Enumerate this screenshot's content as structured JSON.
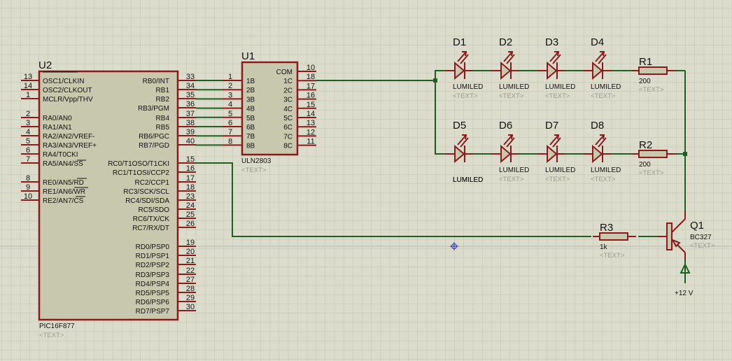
{
  "colors": {
    "background": "#dcdccc",
    "grid": "#c4c4b4",
    "wire": "#1f5f1f",
    "pin": "#8b1a1a",
    "body": "#c8c8ae",
    "cursor": "#2030c0"
  },
  "placeholder": "<TEXT>",
  "u2": {
    "ref": "U2",
    "value": "PIC16F877",
    "text": "<TEXT>",
    "left_pins": [
      {
        "num": "13",
        "label": "OSC1/CLKIN"
      },
      {
        "num": "14",
        "label": "OSC2/CLKOUT"
      },
      {
        "num": "1",
        "label": "MCLR/Vpp/THV"
      },
      {
        "num": "2",
        "label": "RA0/AN0"
      },
      {
        "num": "3",
        "label": "RA1/AN1"
      },
      {
        "num": "4",
        "label": "RA2/AN2/VREF-"
      },
      {
        "num": "5",
        "label": "RA3/AN3/VREF+"
      },
      {
        "num": "6",
        "label": "RA4/T0CKI"
      },
      {
        "num": "7",
        "label": "RA5/AN4/SS"
      },
      {
        "num": "8",
        "label": "RE0/AN5/RD"
      },
      {
        "num": "9",
        "label": "RE1/AN6/WR"
      },
      {
        "num": "10",
        "label": "RE2/AN7/CS"
      }
    ],
    "right_pins": [
      {
        "num": "33",
        "label": "RB0/INT"
      },
      {
        "num": "34",
        "label": "RB1"
      },
      {
        "num": "35",
        "label": "RB2"
      },
      {
        "num": "36",
        "label": "RB3/PGM"
      },
      {
        "num": "37",
        "label": "RB4"
      },
      {
        "num": "38",
        "label": "RB5"
      },
      {
        "num": "39",
        "label": "RB6/PGC"
      },
      {
        "num": "40",
        "label": "RB7/PGD"
      },
      {
        "num": "15",
        "label": "RC0/T1OSO/T1CKI"
      },
      {
        "num": "16",
        "label": "RC1/T1OSI/CCP2"
      },
      {
        "num": "17",
        "label": "RC2/CCP1"
      },
      {
        "num": "18",
        "label": "RC3/SCK/SCL"
      },
      {
        "num": "23",
        "label": "RC4/SDI/SDA"
      },
      {
        "num": "24",
        "label": "RC5/SDO"
      },
      {
        "num": "25",
        "label": "RC6/TX/CK"
      },
      {
        "num": "26",
        "label": "RC7/RX/DT"
      },
      {
        "num": "19",
        "label": "RD0/PSP0"
      },
      {
        "num": "20",
        "label": "RD1/PSP1"
      },
      {
        "num": "21",
        "label": "RD2/PSP2"
      },
      {
        "num": "22",
        "label": "RD3/PSP3"
      },
      {
        "num": "27",
        "label": "RD4/PSP4"
      },
      {
        "num": "28",
        "label": "RD5/PSP5"
      },
      {
        "num": "29",
        "label": "RD6/PSP6"
      },
      {
        "num": "30",
        "label": "RD7/PSP7"
      }
    ]
  },
  "u1": {
    "ref": "U1",
    "value": "ULN2803",
    "text": "<TEXT>",
    "left_pins": [
      {
        "num": "1",
        "label": "1B"
      },
      {
        "num": "2",
        "label": "2B"
      },
      {
        "num": "3",
        "label": "3B"
      },
      {
        "num": "4",
        "label": "4B"
      },
      {
        "num": "5",
        "label": "5B"
      },
      {
        "num": "6",
        "label": "6B"
      },
      {
        "num": "7",
        "label": "7B"
      },
      {
        "num": "8",
        "label": "8B"
      }
    ],
    "right_pins": [
      {
        "num": "10",
        "label": "COM"
      },
      {
        "num": "18",
        "label": "1C"
      },
      {
        "num": "17",
        "label": "2C"
      },
      {
        "num": "16",
        "label": "3C"
      },
      {
        "num": "15",
        "label": "4C"
      },
      {
        "num": "14",
        "label": "5C"
      },
      {
        "num": "13",
        "label": "6C"
      },
      {
        "num": "12",
        "label": "7C"
      },
      {
        "num": "11",
        "label": "8C"
      }
    ]
  },
  "leds": [
    {
      "ref": "D1",
      "value": "LUMILED",
      "text": "<TEXT>"
    },
    {
      "ref": "D2",
      "value": "LUMILED",
      "text": "<TEXT>"
    },
    {
      "ref": "D3",
      "value": "LUMILED",
      "text": "<TEXT>"
    },
    {
      "ref": "D4",
      "value": "LUMILED",
      "text": "<TEXT>"
    },
    {
      "ref": "D5",
      "value": "LUMILED",
      "text": "LUMILED"
    },
    {
      "ref": "D6",
      "value": "LUMILED",
      "text": "<TEXT>"
    },
    {
      "ref": "D7",
      "value": "LUMILED",
      "text": "<TEXT>"
    },
    {
      "ref": "D8",
      "value": "LUMILED",
      "text": "<TEXT>"
    }
  ],
  "resistors": [
    {
      "ref": "R1",
      "value": "200",
      "text": "<TEXT>"
    },
    {
      "ref": "R2",
      "value": "200",
      "text": "<TEXT>"
    },
    {
      "ref": "R3",
      "value": "1k",
      "text": "<TEXT>"
    }
  ],
  "q1": {
    "ref": "Q1",
    "value": "BC327",
    "text": "<TEXT>"
  },
  "power": {
    "label": "+12 V"
  }
}
